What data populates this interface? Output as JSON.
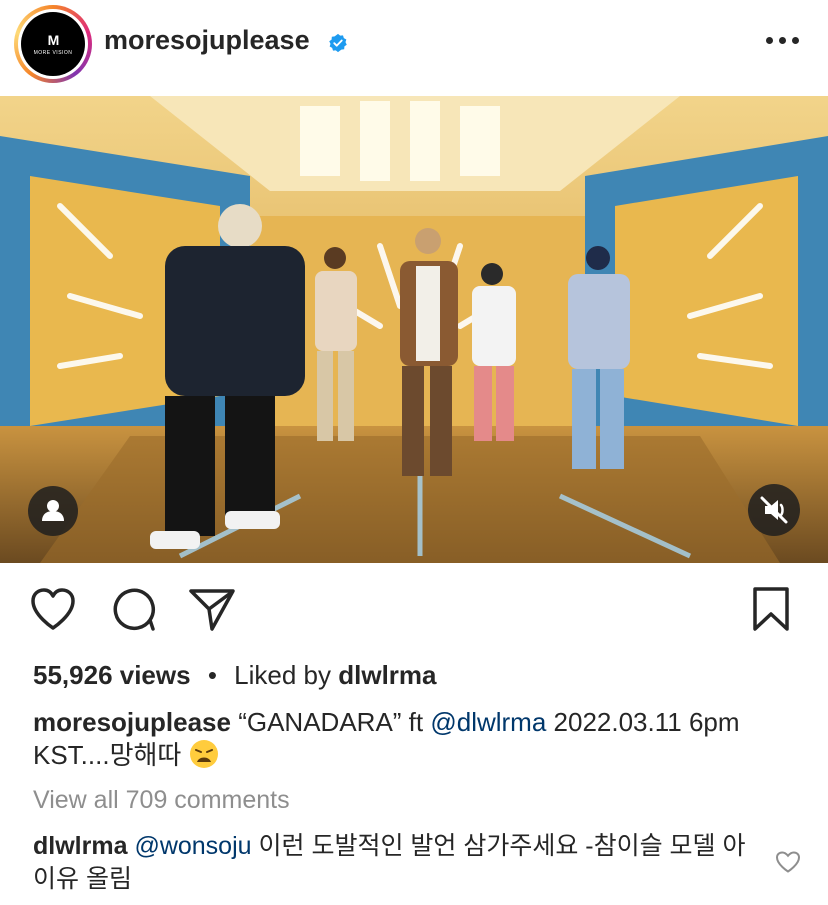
{
  "post": {
    "username": "moresojuplease",
    "avatar_mark": "M",
    "avatar_text": "MORE VISION",
    "verified": true,
    "more_icon": "more-horizontal-icon"
  },
  "media": {
    "type": "video",
    "muted": true,
    "tag_icon": "user-tag-icon",
    "mute_icon": "speaker-muted-icon"
  },
  "actions": {
    "like_icon": "heart-icon",
    "comment_icon": "comment-icon",
    "share_icon": "send-icon",
    "save_icon": "bookmark-icon"
  },
  "stats": {
    "views": "55,926 views",
    "separator": "•",
    "liked_by_prefix": "Liked by",
    "liked_by_user": "dlwlrma"
  },
  "caption": {
    "username": "moresojuplease",
    "text_before": " “GANADARA” ft ",
    "mention": "@dlwlrma",
    "text_after": "  2022.03.11 6pm KST....망해따 ",
    "emoji": "weary-face"
  },
  "comments_link": "View all 709 comments",
  "comment": {
    "username": "dlwlrma",
    "mention": "@wonsoju",
    "text": " 이런 도발적인 발언 삼가주세요 -참이슬 모델 아이유 올림",
    "like_icon": "small-heart-icon"
  }
}
